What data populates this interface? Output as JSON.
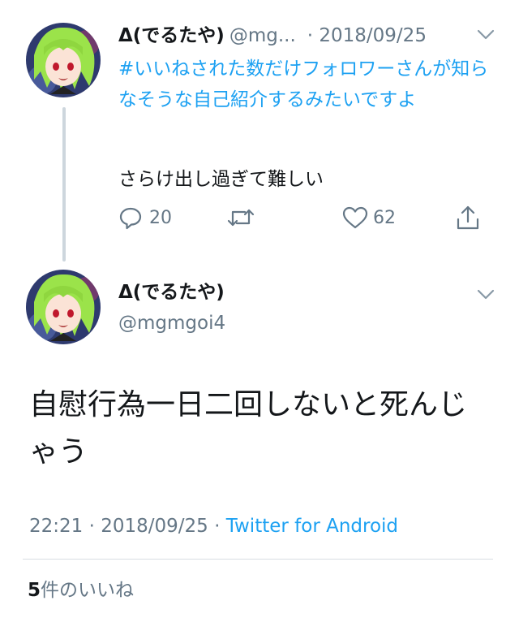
{
  "thread": {
    "parent": {
      "display_name": "Δ(でるたや)",
      "handle": "@mg...",
      "date": "· 2018/09/25",
      "hashtag_text": "#いいねされた数だけフォロワーさんが知らなそうな自己紹介するみたいですよ",
      "body_text": "さらけ出し過ぎて難しい",
      "reply_count": "20",
      "retweet_count": "",
      "like_count": "62",
      "icons": {
        "reply": "reply-icon",
        "retweet": "retweet-icon",
        "like": "heart-icon",
        "share": "share-icon",
        "menu": "chevron-down-icon"
      }
    },
    "main": {
      "display_name": "Δ(でるたや)",
      "handle": "@mgmgoi4",
      "body_text": "自慰行為一日二回しないと死んじゃう",
      "time": "22:21",
      "date": "2018/09/25",
      "separator": "·",
      "source": "Twitter for Android",
      "likes_count": "5",
      "likes_label": "件のいいね"
    }
  },
  "colors": {
    "link": "#1da1f2",
    "secondary_text": "#657786",
    "primary_text": "#14171a",
    "thread_line": "#cdd6dd"
  }
}
